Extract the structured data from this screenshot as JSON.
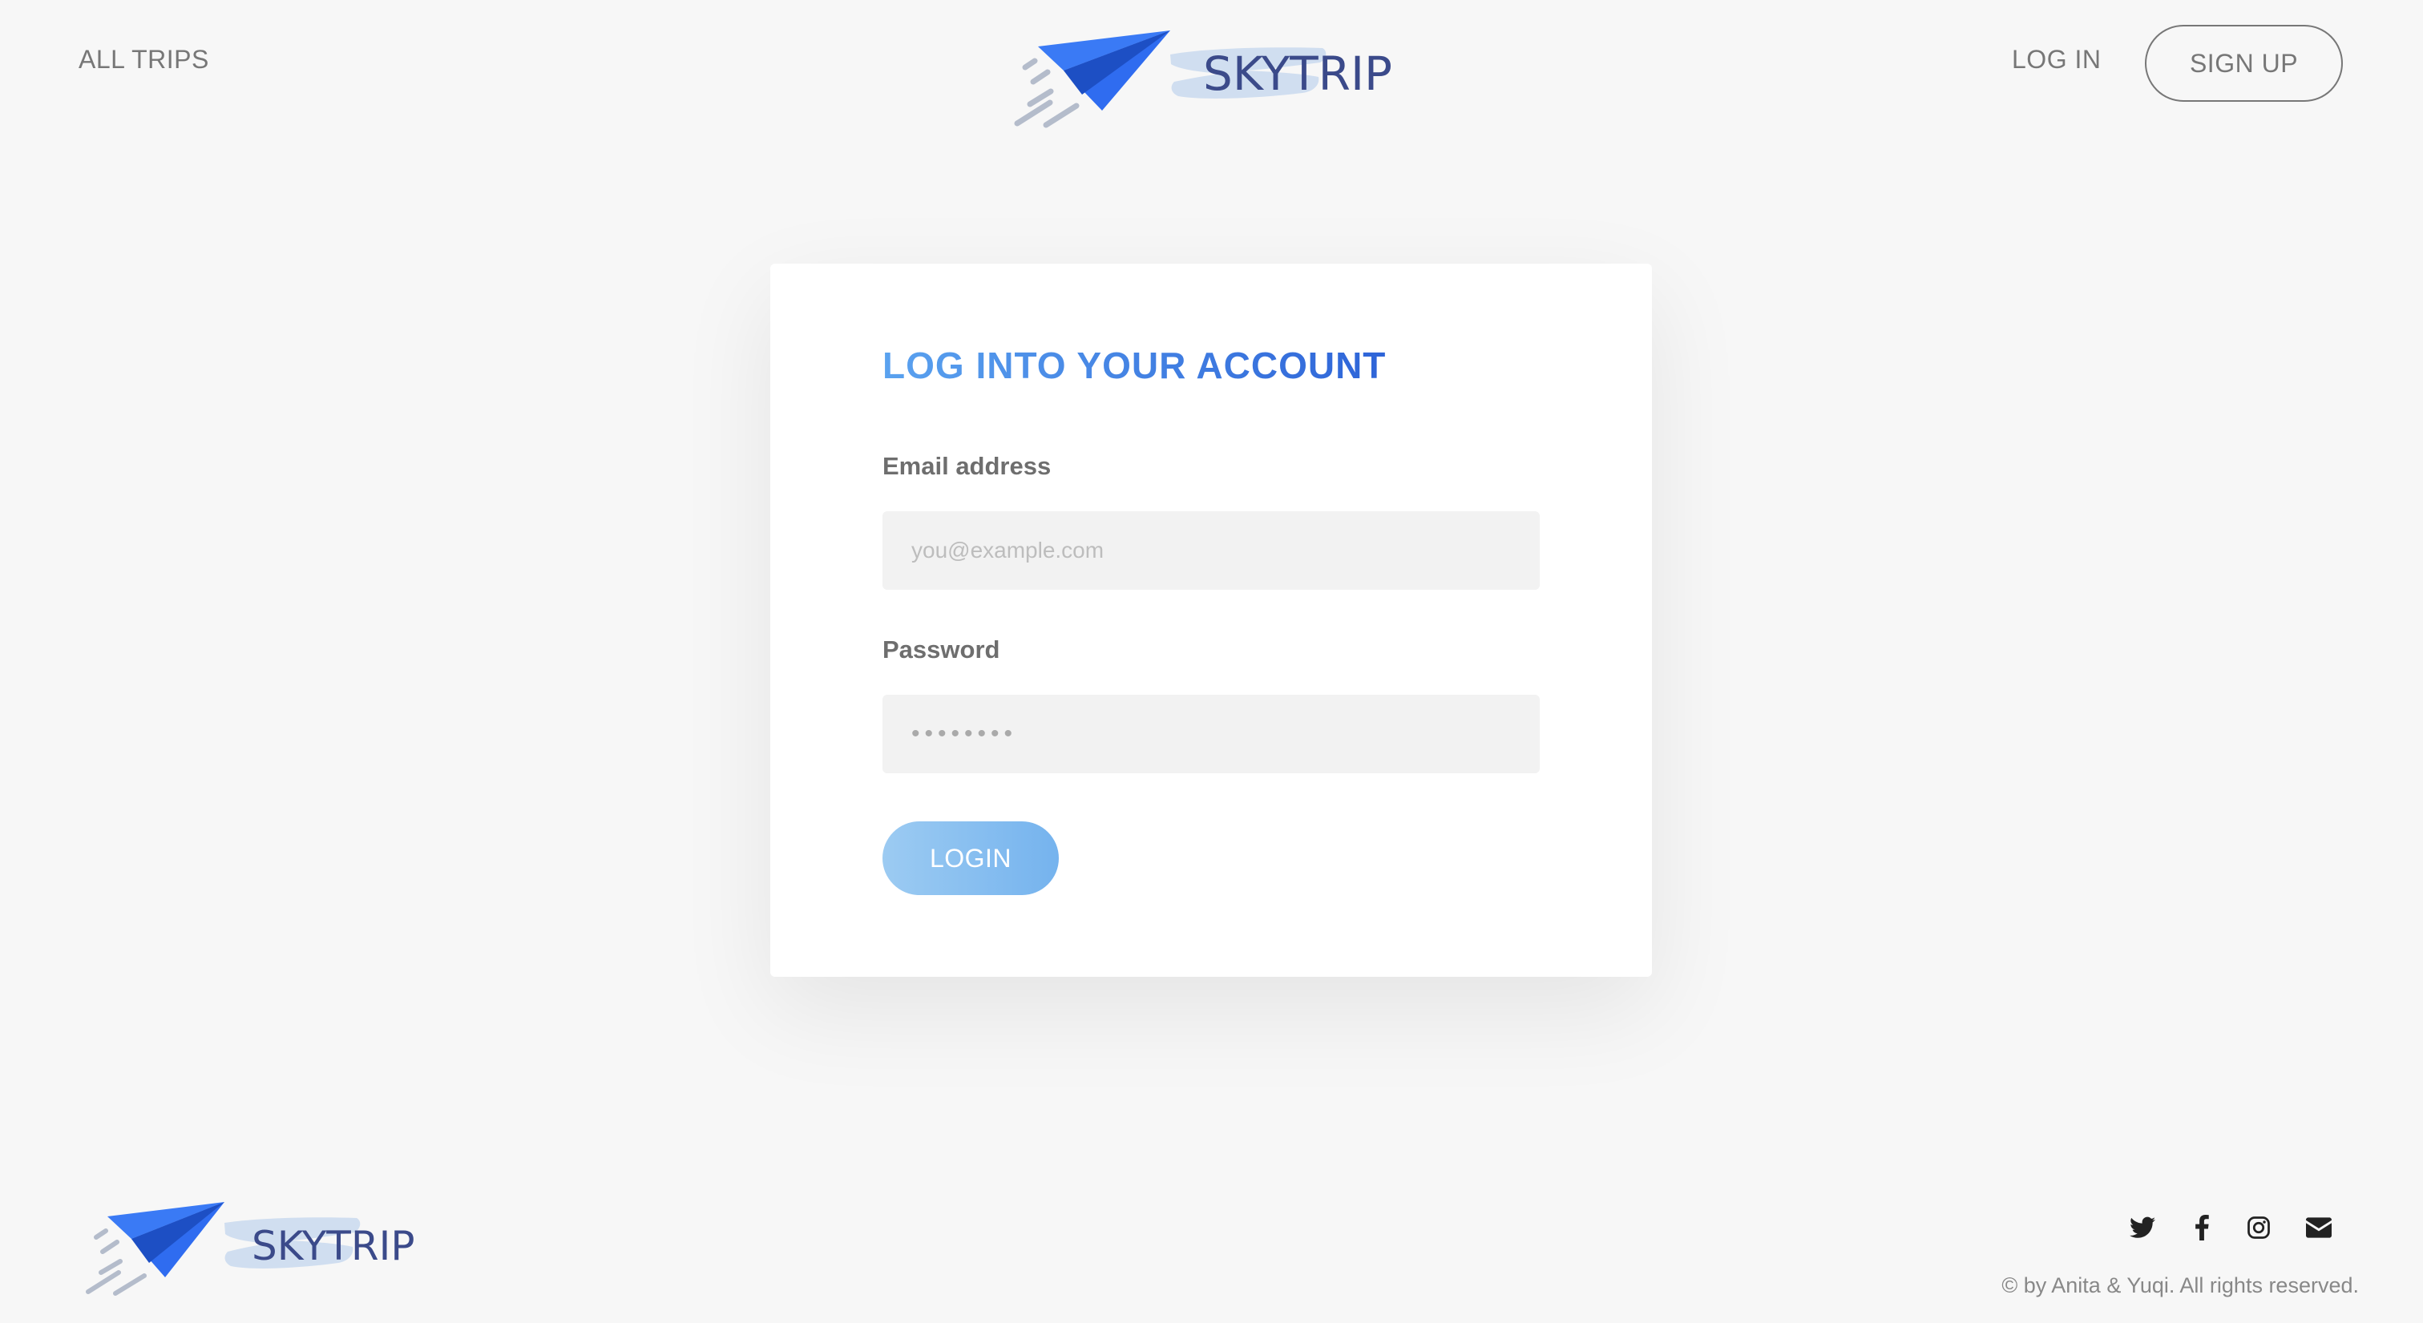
{
  "header": {
    "all_trips": "ALL TRIPS",
    "login": "LOG IN",
    "signup": "SIGN UP",
    "brand": "SKYTRIP"
  },
  "login_form": {
    "title": "LOG INTO YOUR ACCOUNT",
    "email_label": "Email address",
    "email_placeholder": "you@example.com",
    "email_value": "",
    "password_label": "Password",
    "password_placeholder": "••••••••",
    "password_value": "",
    "submit_label": "LOGIN"
  },
  "footer": {
    "brand": "SKYTRIP",
    "social_icons": [
      "twitter-icon",
      "facebook-icon",
      "instagram-icon",
      "mail-icon"
    ],
    "copyright": "© by Anita & Yuqi. All rights reserved."
  },
  "colors": {
    "background": "#f7f7f7",
    "accent_blue": "#2e64d8",
    "title_gradient_start": "#5aa2ef",
    "title_gradient_end": "#2e64d8",
    "button_gradient_start": "#9ccbf2",
    "button_gradient_end": "#75b3ee",
    "brand_text": "#3b4a8a",
    "plane_blue": "#2f6cf0"
  }
}
